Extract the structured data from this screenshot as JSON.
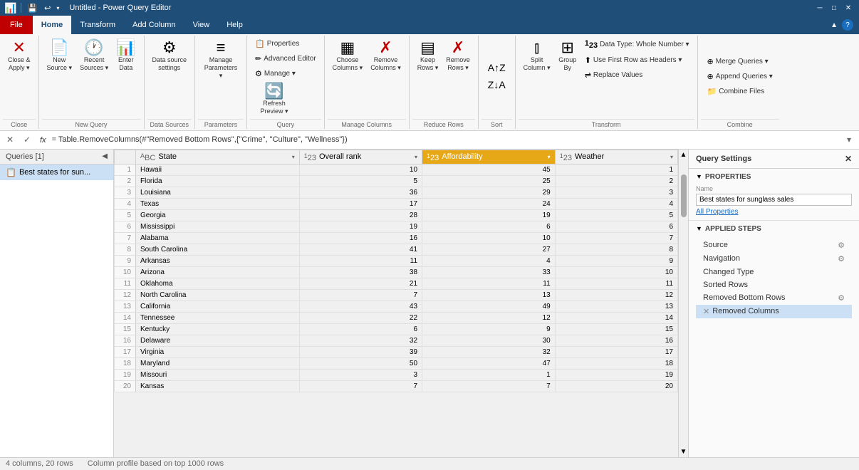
{
  "titleBar": {
    "title": "Untitled - Power Query Editor",
    "controls": [
      "minimize",
      "maximize",
      "close"
    ]
  },
  "ribbon": {
    "tabs": [
      "File",
      "Home",
      "Transform",
      "Add Column",
      "View",
      "Help"
    ],
    "activeTab": "Home",
    "groups": [
      {
        "label": "Close",
        "items": [
          {
            "id": "close-apply",
            "label": "Close &\nApply",
            "icon": "⊠",
            "hasDropdown": true
          }
        ]
      },
      {
        "label": "New Query",
        "items": [
          {
            "id": "new-source",
            "label": "New\nSource",
            "icon": "📄",
            "hasDropdown": true
          },
          {
            "id": "recent-sources",
            "label": "Recent\nSources",
            "icon": "🕐",
            "hasDropdown": true
          },
          {
            "id": "enter-data",
            "label": "Enter\nData",
            "icon": "📊"
          }
        ]
      },
      {
        "label": "Data Sources",
        "items": [
          {
            "id": "data-source-settings",
            "label": "Data source\nsettings",
            "icon": "⚙"
          }
        ]
      },
      {
        "label": "Parameters",
        "items": [
          {
            "id": "manage-parameters",
            "label": "Manage\nParameters",
            "icon": "≡",
            "hasDropdown": true
          }
        ]
      },
      {
        "label": "Query",
        "items": [
          {
            "id": "properties",
            "label": "Properties",
            "icon": "📋",
            "small": true
          },
          {
            "id": "advanced-editor",
            "label": "Advanced Editor",
            "icon": "✏",
            "small": true
          },
          {
            "id": "manage",
            "label": "Manage",
            "icon": "⚙",
            "small": true,
            "hasDropdown": true
          },
          {
            "id": "refresh-preview",
            "label": "Refresh\nPreview",
            "icon": "🔄",
            "hasDropdown": true
          }
        ]
      },
      {
        "label": "Manage Columns",
        "items": [
          {
            "id": "choose-columns",
            "label": "Choose\nColumns",
            "icon": "▦",
            "hasDropdown": true
          },
          {
            "id": "remove-columns",
            "label": "Remove\nColumns",
            "icon": "✗▦",
            "hasDropdown": true
          }
        ]
      },
      {
        "label": "Reduce Rows",
        "items": [
          {
            "id": "keep-rows",
            "label": "Keep\nRows",
            "icon": "▤",
            "hasDropdown": true
          },
          {
            "id": "remove-rows",
            "label": "Remove\nRows",
            "icon": "✗▤",
            "hasDropdown": true
          }
        ]
      },
      {
        "label": "Sort",
        "items": [
          {
            "id": "sort-asc",
            "label": "",
            "icon": "↑Z"
          },
          {
            "id": "sort-desc",
            "label": "",
            "icon": "↓A"
          }
        ]
      },
      {
        "label": "Transform",
        "items": [
          {
            "id": "split-column",
            "label": "Split\nColumn",
            "icon": "⫾",
            "hasDropdown": true
          },
          {
            "id": "group-by",
            "label": "Group\nBy",
            "icon": "⊞"
          },
          {
            "id": "data-type",
            "label": "Data Type: Whole Number",
            "icon": "123",
            "small": true,
            "hasDropdown": true
          },
          {
            "id": "first-row-headers",
            "label": "Use First Row as Headers",
            "icon": "⬆",
            "small": true,
            "hasDropdown": true
          },
          {
            "id": "replace-values",
            "label": "Replace Values",
            "icon": "⇌",
            "small": true
          }
        ]
      },
      {
        "label": "Combine",
        "items": [
          {
            "id": "merge-queries",
            "label": "Merge Queries",
            "icon": "⊕",
            "small": true,
            "hasDropdown": true
          },
          {
            "id": "append-queries",
            "label": "Append Queries",
            "icon": "⊕",
            "small": true,
            "hasDropdown": true
          },
          {
            "id": "combine-files",
            "label": "Combine Files",
            "icon": "📁",
            "small": true
          }
        ]
      }
    ]
  },
  "formulaBar": {
    "formula": "= Table.RemoveColumns(#\"Removed Bottom Rows\",{\"Crime\", \"Culture\", \"Wellness\"})"
  },
  "queries": {
    "header": "Queries [1]",
    "items": [
      {
        "id": "best-states",
        "label": "Best states for sun...",
        "icon": "📋"
      }
    ]
  },
  "table": {
    "columns": [
      {
        "id": "state",
        "label": "State",
        "type": "ABC",
        "highlighted": false
      },
      {
        "id": "overall-rank",
        "label": "Overall rank",
        "type": "123",
        "highlighted": false
      },
      {
        "id": "affordability",
        "label": "Affordability",
        "type": "123",
        "highlighted": true
      },
      {
        "id": "weather",
        "label": "Weather",
        "type": "123",
        "highlighted": false
      }
    ],
    "rows": [
      {
        "num": 1,
        "state": "Hawaii",
        "overallRank": 10,
        "affordability": 45,
        "weather": 1
      },
      {
        "num": 2,
        "state": "Florida",
        "overallRank": 5,
        "affordability": 25,
        "weather": 2
      },
      {
        "num": 3,
        "state": "Louisiana",
        "overallRank": 36,
        "affordability": 29,
        "weather": 3
      },
      {
        "num": 4,
        "state": "Texas",
        "overallRank": 17,
        "affordability": 24,
        "weather": 4
      },
      {
        "num": 5,
        "state": "Georgia",
        "overallRank": 28,
        "affordability": 19,
        "weather": 5
      },
      {
        "num": 6,
        "state": "Mississippi",
        "overallRank": 19,
        "affordability": 6,
        "weather": 6
      },
      {
        "num": 7,
        "state": "Alabama",
        "overallRank": 16,
        "affordability": 10,
        "weather": 7
      },
      {
        "num": 8,
        "state": "South Carolina",
        "overallRank": 41,
        "affordability": 27,
        "weather": 8
      },
      {
        "num": 9,
        "state": "Arkansas",
        "overallRank": 11,
        "affordability": 4,
        "weather": 9
      },
      {
        "num": 10,
        "state": "Arizona",
        "overallRank": 38,
        "affordability": 33,
        "weather": 10
      },
      {
        "num": 11,
        "state": "Oklahoma",
        "overallRank": 21,
        "affordability": 11,
        "weather": 11
      },
      {
        "num": 12,
        "state": "North Carolina",
        "overallRank": 7,
        "affordability": 13,
        "weather": 12
      },
      {
        "num": 13,
        "state": "California",
        "overallRank": 43,
        "affordability": 49,
        "weather": 13
      },
      {
        "num": 14,
        "state": "Tennessee",
        "overallRank": 22,
        "affordability": 12,
        "weather": 14
      },
      {
        "num": 15,
        "state": "Kentucky",
        "overallRank": 6,
        "affordability": 9,
        "weather": 15
      },
      {
        "num": 16,
        "state": "Delaware",
        "overallRank": 32,
        "affordability": 30,
        "weather": 16
      },
      {
        "num": 17,
        "state": "Virginia",
        "overallRank": 39,
        "affordability": 32,
        "weather": 17
      },
      {
        "num": 18,
        "state": "Maryland",
        "overallRank": 50,
        "affordability": 47,
        "weather": 18
      },
      {
        "num": 19,
        "state": "Missouri",
        "overallRank": 3,
        "affordability": 1,
        "weather": 19
      },
      {
        "num": 20,
        "state": "Kansas",
        "overallRank": 7,
        "affordability": 7,
        "weather": 20
      }
    ]
  },
  "querySettings": {
    "title": "Query Settings",
    "propertiesTitle": "PROPERTIES",
    "nameLabel": "Name",
    "nameValue": "Best states for sunglass sales",
    "allPropertiesLink": "All Properties",
    "appliedStepsTitle": "APPLIED STEPS",
    "steps": [
      {
        "id": "source",
        "label": "Source",
        "hasGear": true,
        "hasX": false,
        "selected": false
      },
      {
        "id": "navigation",
        "label": "Navigation",
        "hasGear": true,
        "hasX": false,
        "selected": false
      },
      {
        "id": "changed-type",
        "label": "Changed Type",
        "hasGear": false,
        "hasX": false,
        "selected": false
      },
      {
        "id": "sorted-rows",
        "label": "Sorted Rows",
        "hasGear": false,
        "hasX": false,
        "selected": false
      },
      {
        "id": "removed-bottom-rows",
        "label": "Removed Bottom Rows",
        "hasGear": true,
        "hasX": false,
        "selected": false
      },
      {
        "id": "removed-columns",
        "label": "Removed Columns",
        "hasGear": false,
        "hasX": true,
        "selected": true
      }
    ]
  },
  "statusBar": {
    "columns": "4 columns, 20 rows",
    "columnProfile": "Column profile based on top 1000 rows"
  }
}
